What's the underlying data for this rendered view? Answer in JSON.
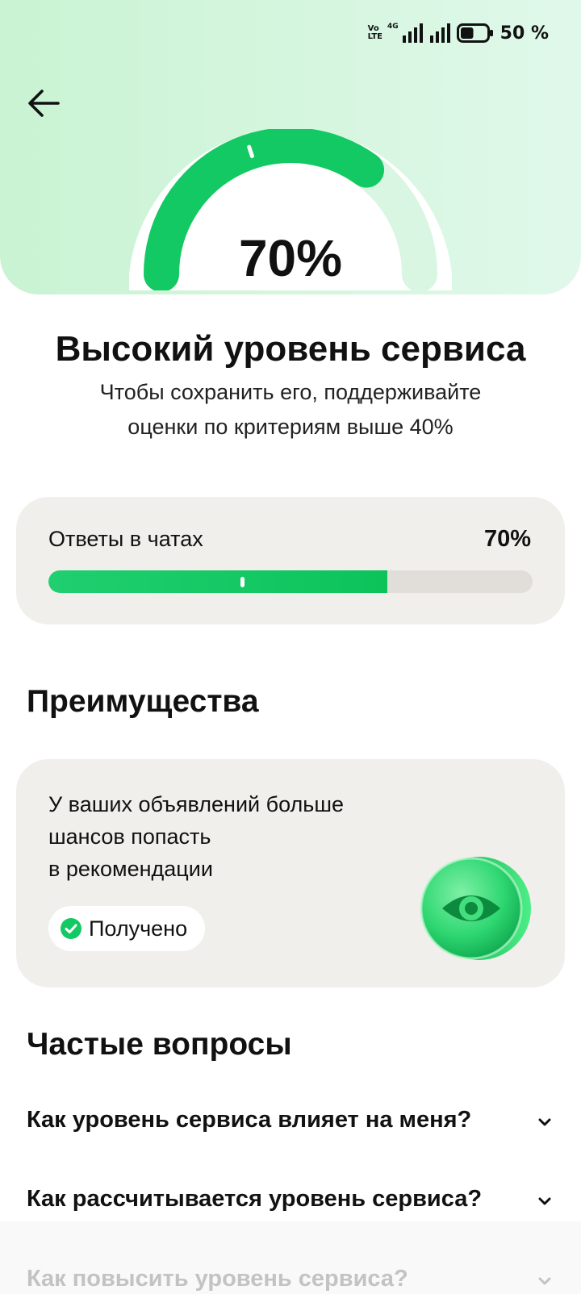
{
  "status_bar": {
    "volte_line1": "Vo",
    "volte_line2": "LTE",
    "network": "4G",
    "battery": "50 %",
    "battery_level": 0.5
  },
  "header": {
    "back_icon": "arrow-left-icon"
  },
  "gauge": {
    "value": 0.7,
    "threshold": 0.4,
    "label": "70%",
    "colors": {
      "fill": "#13c963",
      "track": "#d9f6e2"
    }
  },
  "level": {
    "title": "Высокий уровень сервиса",
    "subtitle_line1": "Чтобы сохранить его, поддерживайте",
    "subtitle_line2": "оценки по критериям выше 40%"
  },
  "criteria": {
    "chats": {
      "label": "Ответы в чатах",
      "value_text": "70%",
      "value": 0.7,
      "threshold": 0.4
    }
  },
  "benefits": {
    "title": "Преимущества",
    "items": [
      {
        "text_line1": "У ваших объявлений больше",
        "text_line2": "шансов попасть",
        "text_line3": "в рекомендации",
        "status": "Получено",
        "status_icon": "check-circle-icon",
        "badge_icon": "eye-icon"
      }
    ]
  },
  "faq": {
    "title": "Частые вопросы",
    "items": [
      {
        "question": "Как уровень сервиса влияет на меня?"
      },
      {
        "question": "Как рассчитывается уровень сервиса?"
      },
      {
        "question": "Как повысить уровень сервиса?"
      }
    ]
  },
  "colors": {
    "accent": "#13c963",
    "card_bg": "#f1efec",
    "hero_bg": "#d4f5dd"
  }
}
